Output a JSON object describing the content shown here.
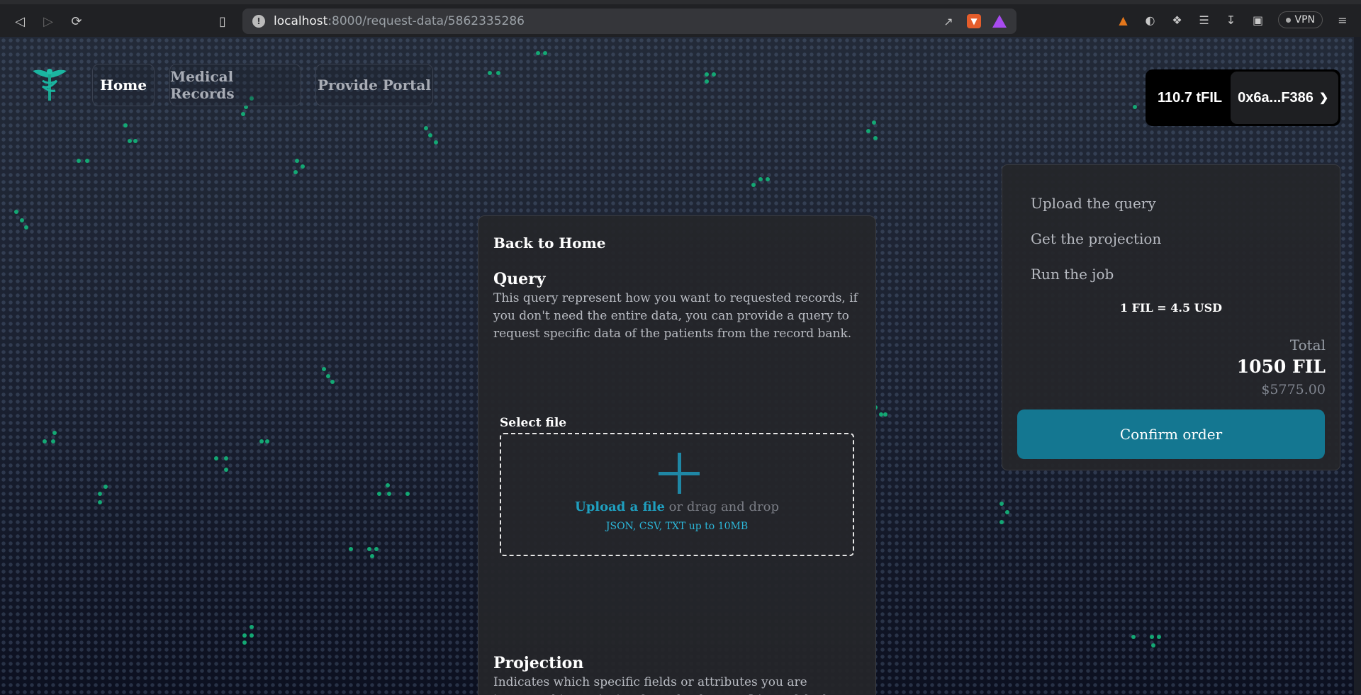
{
  "browser": {
    "url_host": "localhost",
    "url_path": ":8000/request-data/5862335286",
    "vpn_label": "VPN"
  },
  "nav": {
    "items": [
      {
        "label": "Home"
      },
      {
        "label": "Medical Records"
      },
      {
        "label": "Provide Portal"
      }
    ]
  },
  "wallet": {
    "balance": "110.7 tFIL",
    "account": "0x6a...F386"
  },
  "main": {
    "back_label": "Back to Home",
    "query": {
      "title": "Query",
      "description": "This query represent how you want to requested records, if you don't need the entire data, you can provide a query to request specific data of the patients from the record bank."
    },
    "upload": {
      "select_label": "Select file",
      "link_text": "Upload a file",
      "rest_text": " or drag and drop",
      "hint": "JSON, CSV, TXT up to 10MB"
    },
    "projection": {
      "title": "Projection",
      "description": "Indicates which specific fields or attributes you are interested in retrieving from the dataset. It's useful when working with large datasets."
    }
  },
  "order": {
    "steps": [
      "Upload the query",
      "Get the projection",
      "Run the job"
    ],
    "rate": "1 FIL = 4.5 USD",
    "total_label": "Total",
    "total_fil": "1050 FIL",
    "total_usd": "$5775.00",
    "confirm_label": "Confirm order"
  },
  "colors": {
    "accent": "#147791",
    "link": "#1f9fbf",
    "dots": "#14a874"
  }
}
